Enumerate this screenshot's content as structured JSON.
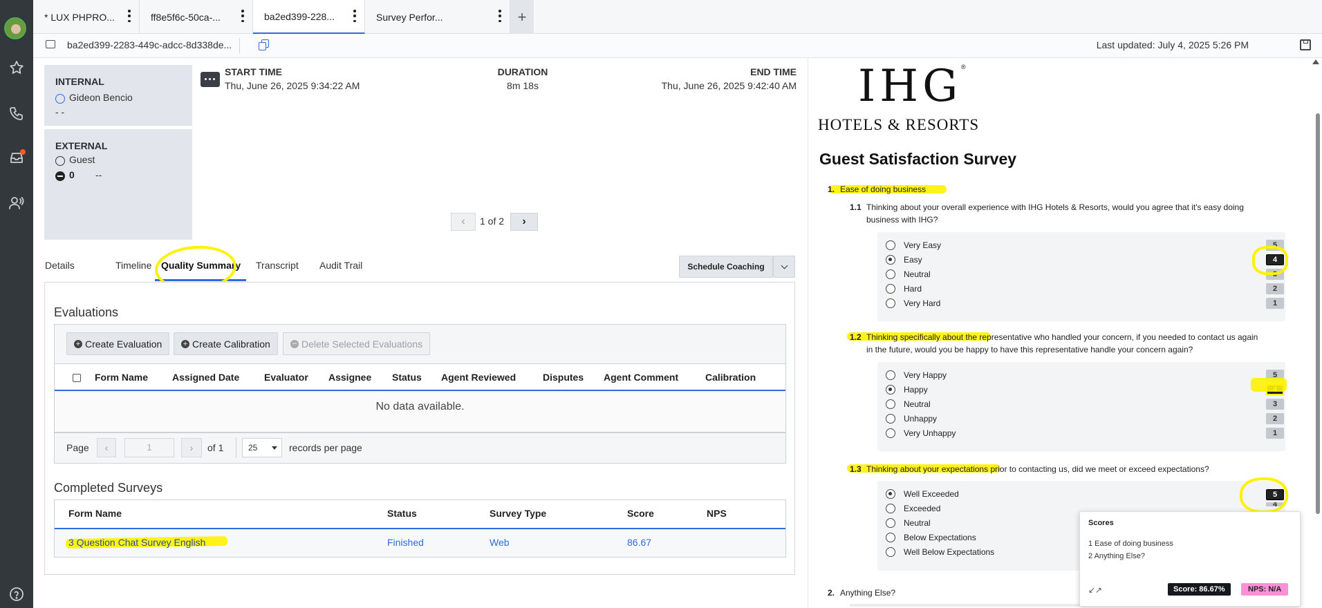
{
  "tabs": [
    {
      "label": "* LUX PHPRO..."
    },
    {
      "label": "ff8e5f6c-50ca-..."
    },
    {
      "label": "ba2ed399-228..."
    },
    {
      "label": "Survey Perfor..."
    }
  ],
  "subbar": {
    "conversation_id": "ba2ed399-2283-449c-adcc-8d338de...",
    "last_updated": "Last updated: July 4, 2025 5:26 PM"
  },
  "participants": {
    "internal": {
      "heading": "INTERNAL",
      "name": "Gideon Bencio",
      "extra": "- -"
    },
    "external": {
      "heading": "EXTERNAL",
      "name": "Guest",
      "count": "0",
      "extra": "--"
    }
  },
  "timing": {
    "start_label": "START TIME",
    "start_value": "Thu, June 26, 2025 9:34:22 AM",
    "duration_label": "DURATION",
    "duration_value": "8m 18s",
    "end_label": "END TIME",
    "end_value": "Thu, June 26, 2025 9:42:40 AM"
  },
  "pager": {
    "text": "1 of 2"
  },
  "detail_tabs": [
    "Details",
    "Timeline",
    "Quality Summary",
    "Transcript",
    "Audit Trail"
  ],
  "actions": {
    "schedule_coaching": "Schedule Coaching"
  },
  "evaluations": {
    "title": "Evaluations",
    "create_evaluation": "Create Evaluation",
    "create_calibration": "Create Calibration",
    "delete_selected": "Delete Selected Evaluations",
    "columns": [
      "Form Name",
      "Assigned Date",
      "Evaluator",
      "Assignee",
      "Status",
      "Agent Reviewed",
      "Disputes",
      "Agent Comment",
      "Calibration"
    ],
    "empty": "No data available.",
    "page_label": "Page",
    "page_value": "1",
    "of_label": "of 1",
    "page_size": "25",
    "records_label": "records per page"
  },
  "surveys": {
    "title": "Completed Surveys",
    "columns": [
      "Form Name",
      "Status",
      "Survey Type",
      "Score",
      "NPS"
    ],
    "rows": [
      {
        "form_name": "3 Question Chat Survey English",
        "status": "Finished",
        "type": "Web",
        "score": "86.67",
        "nps": ""
      }
    ]
  },
  "form": {
    "brand_main": "IHG",
    "brand_sub": "HOTELS & RESORTS",
    "title": "Guest Satisfaction Survey",
    "sections": [
      {
        "num": "1.",
        "title": "Ease of doing business"
      },
      {
        "num": "2.",
        "title": "Anything Else?"
      }
    ],
    "questions": [
      {
        "num": "1.1",
        "text1": "Thinking about your overall experience with IHG Hotels & Resorts, would you agree that it's easy doing",
        "text2": "business with IHG?",
        "options": [
          "Very Easy",
          "Easy",
          "Neutral",
          "Hard",
          "Very Hard"
        ],
        "scores": [
          "5",
          "4",
          "3",
          "2",
          "1"
        ],
        "selected": 1
      },
      {
        "num": "1.2",
        "text1": "Thinking specifically about the representative who handled your concern, if you needed to contact us again",
        "text2": "in the future, would you be happy to have this representative handle your concern again?",
        "options": [
          "Very Happy",
          "Happy",
          "Neutral",
          "Unhappy",
          "Very Unhappy"
        ],
        "scores": [
          "5",
          "4",
          "3",
          "2",
          "1"
        ],
        "selected": 1
      },
      {
        "num": "1.3",
        "text1": "Thinking about your expectations prior to contacting us, did we meet or exceed expectations?",
        "text2": "",
        "options": [
          "Well Exceeded",
          "Exceeded",
          "Neutral",
          "Below Expectations",
          "Well Below Expectations"
        ],
        "scores": [
          "5",
          "4"
        ],
        "selected": 0
      }
    ]
  },
  "scores_popup": {
    "title": "Scores",
    "items": [
      "1 Ease of doing business",
      "2 Anything Else?"
    ],
    "score": "Score: 86.67%",
    "nps": "NPS: N/A"
  },
  "colors": {
    "accent": "#2e6bdb",
    "highlight": "#fff200",
    "nps_badge": "#ff8fd6"
  }
}
